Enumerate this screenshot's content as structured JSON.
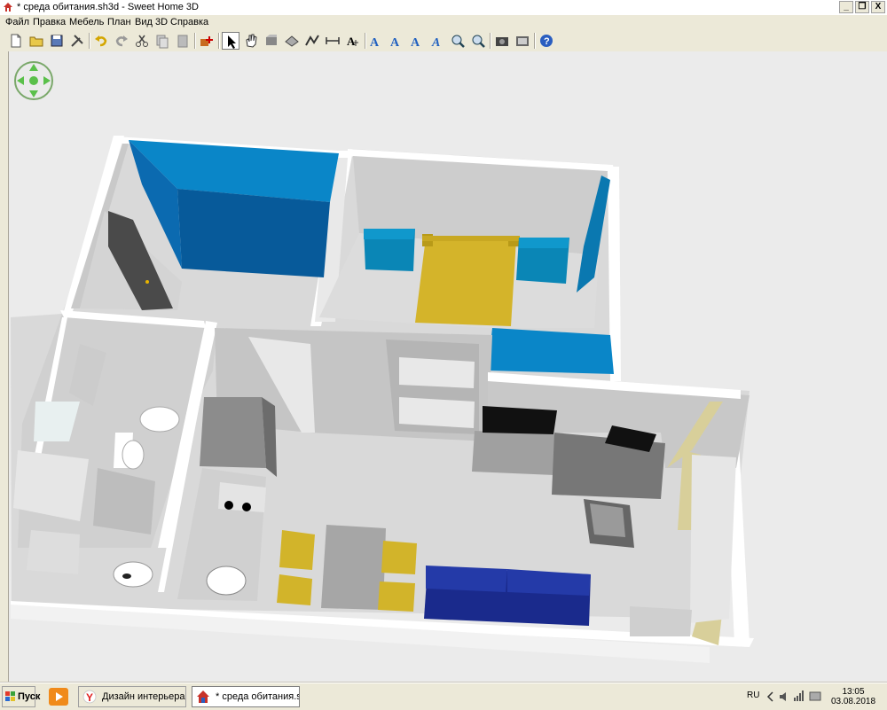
{
  "window": {
    "title": "* среда обитания.sh3d - Sweet Home 3D",
    "minimize_label": "_",
    "maximize_label": "❐",
    "close_label": "X"
  },
  "menu": {
    "items": [
      "Файл",
      "Правка",
      "Мебель",
      "План",
      "Вид 3D",
      "Справка"
    ]
  },
  "toolbar": {
    "buttons": [
      "new-home",
      "open",
      "save",
      "cut-home",
      "undo",
      "redo",
      "cut",
      "copy",
      "paste",
      "add-furniture",
      "select",
      "pan",
      "create-walls",
      "create-rooms",
      "create-polylines",
      "create-dimensions",
      "add-text",
      "modify-text-style",
      "increase-text-size",
      "decrease-text-size",
      "bold-text",
      "italic-text",
      "zoom-in",
      "zoom-out",
      "create-photo",
      "create-video",
      "help"
    ]
  },
  "taskbar": {
    "start_label": "Пуск",
    "tasks": [
      {
        "label": "Дизайн интерьера ...",
        "icon": "yandex-browser-icon"
      },
      {
        "label": "* среда обитания.s...",
        "icon": "sweethome3d-icon"
      }
    ],
    "language": "RU",
    "time": "13:05",
    "date": "03.08.2018"
  },
  "colors": {
    "wardrobe_blue": "#0a72bd",
    "teal_furniture": "#0a86b6",
    "yellow_wood": "#d2b42a",
    "sofa_navy": "#1a2a8c",
    "wall_white": "#ffffff",
    "floor_grey": "#d9d9d9"
  }
}
